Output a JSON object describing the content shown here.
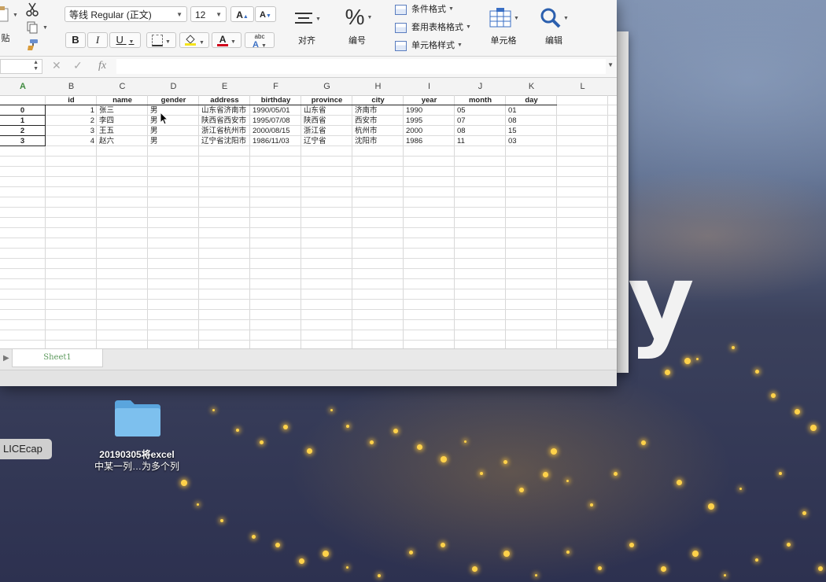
{
  "ribbon": {
    "paste_label": "贴",
    "font_name": "等线 Regular (正文)",
    "font_size": "12",
    "bold": "B",
    "italic": "I",
    "underline": "U",
    "font_color_letter": "A",
    "phonetic_label": "abc",
    "align_label": "对齐",
    "number_symbol": "%",
    "number_label": "编号",
    "conditional_format": "条件格式",
    "table_format": "套用表格格式",
    "cell_style": "单元格样式",
    "cells_label": "单元格",
    "edit_label": "编辑",
    "grow_font": "A",
    "shrink_font": "A"
  },
  "formula_bar": {
    "fx": "fx",
    "cell_ref": "",
    "formula": ""
  },
  "columns": [
    "A",
    "B",
    "C",
    "D",
    "E",
    "F",
    "G",
    "H",
    "I",
    "J",
    "K",
    "L"
  ],
  "sheet": {
    "headers": [
      "id",
      "name",
      "gender",
      "address",
      "birthday",
      "province",
      "city",
      "year",
      "month",
      "day"
    ],
    "rows": [
      {
        "index": "0",
        "id": "1",
        "name": "张三",
        "gender": "男",
        "address": "山东省济南市",
        "birthday": "1990/05/01",
        "province": "山东省",
        "city": "济南市",
        "year": "1990",
        "month": "05",
        "day": "01"
      },
      {
        "index": "1",
        "id": "2",
        "name": "李四",
        "gender": "男",
        "address": "陕西省西安市",
        "birthday": "1995/07/08",
        "province": "陕西省",
        "city": "西安市",
        "year": "1995",
        "month": "07",
        "day": "08"
      },
      {
        "index": "2",
        "id": "3",
        "name": "王五",
        "gender": "男",
        "address": "浙江省杭州市",
        "birthday": "2000/08/15",
        "province": "浙江省",
        "city": "杭州市",
        "year": "2000",
        "month": "08",
        "day": "15"
      },
      {
        "index": "3",
        "id": "4",
        "name": "赵六",
        "gender": "男",
        "address": "辽宁省沈阳市",
        "birthday": "1986/11/03",
        "province": "辽宁省",
        "city": "沈阳市",
        "year": "1986",
        "month": "11",
        "day": "03"
      }
    ]
  },
  "tabs": {
    "sheet1": "Sheet1"
  },
  "desktop": {
    "folder_line1": "20190305将excel",
    "folder_line2": "中某一列…为多个列",
    "licecap": "LICEcap",
    "wallpaper_letter": "y"
  },
  "colors": {
    "accent_green": "#5e9a5e",
    "highlight_yellow": "#f5e31a",
    "font_red": "#d0021b",
    "excel_blue": "#5a7dbf"
  }
}
